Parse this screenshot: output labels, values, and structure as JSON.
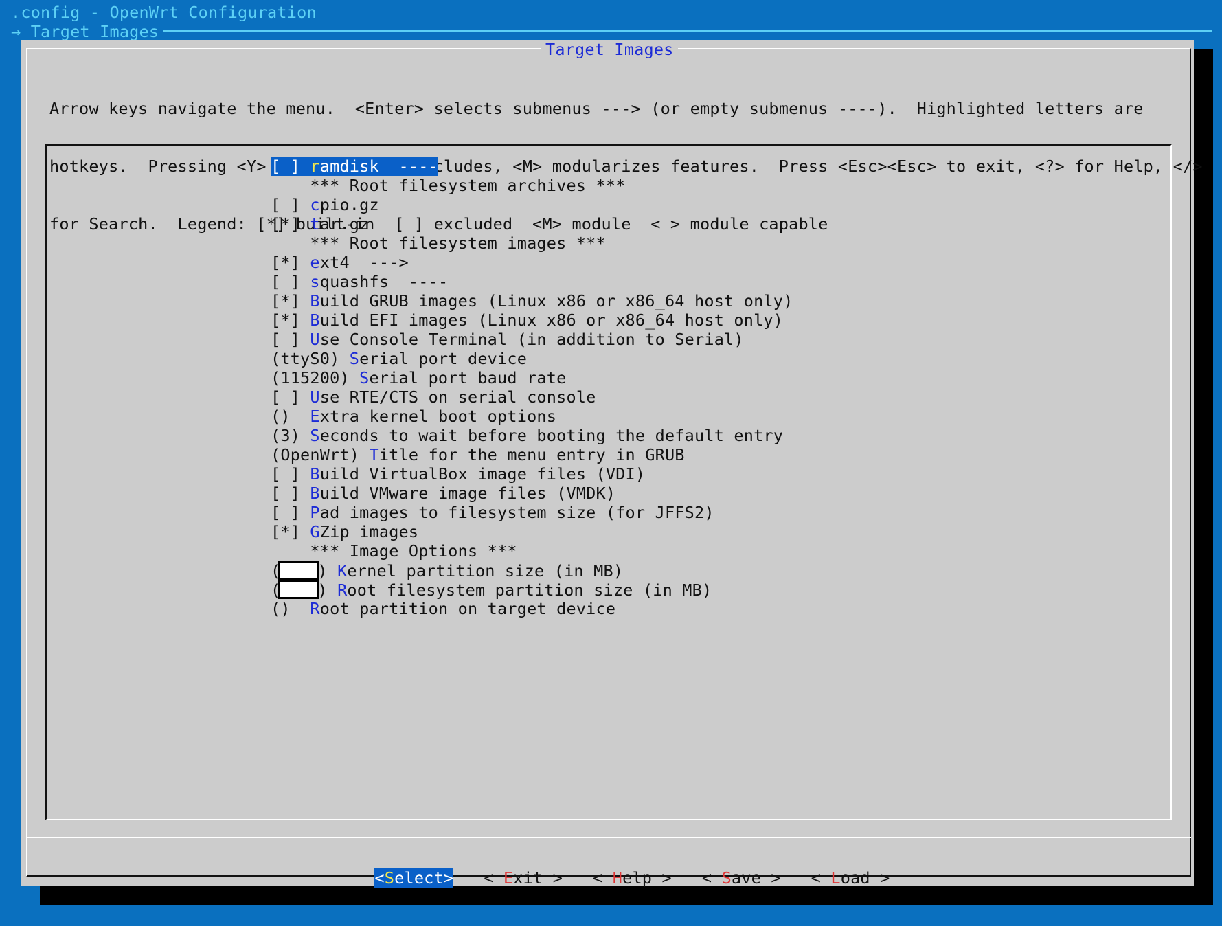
{
  "window": {
    "title": ".config - OpenWrt Configuration",
    "breadcrumb": "→ Target Images"
  },
  "dialog": {
    "title": "Target Images",
    "help_lines": [
      "Arrow keys navigate the menu.  <Enter> selects submenus ---> (or empty submenus ----).  Highlighted letters are",
      "hotkeys.  Pressing <Y> includes, <N> excludes, <M> modularizes features.  Press <Esc><Esc> to exit, <?> for Help, </>",
      "for Search.  Legend: [*] built-in  [ ] excluded  <M> module  < > module capable"
    ]
  },
  "menu": {
    "items": [
      {
        "prefix": "[ ] ",
        "hotkey": "r",
        "rest": "amdisk  ----",
        "selected": true,
        "interactive": true
      },
      {
        "prefix": "    ",
        "hotkey": "",
        "rest": "*** Root filesystem archives ***",
        "interactive": false
      },
      {
        "prefix": "[ ] ",
        "hotkey": "c",
        "rest": "pio.gz",
        "interactive": true
      },
      {
        "prefix": "[*] ",
        "hotkey": "t",
        "rest": "ar.gz",
        "interactive": true
      },
      {
        "prefix": "    ",
        "hotkey": "",
        "rest": "*** Root filesystem images ***",
        "interactive": false
      },
      {
        "prefix": "[*] ",
        "hotkey": "e",
        "rest": "xt4  --->",
        "interactive": true
      },
      {
        "prefix": "[ ] ",
        "hotkey": "s",
        "rest": "quashfs  ----",
        "interactive": true
      },
      {
        "prefix": "[*] ",
        "hotkey": "B",
        "rest": "uild GRUB images (Linux x86 or x86_64 host only)",
        "interactive": true
      },
      {
        "prefix": "[*] ",
        "hotkey": "B",
        "rest": "uild EFI images (Linux x86 or x86_64 host only)",
        "interactive": true
      },
      {
        "prefix": "[ ] ",
        "hotkey": "U",
        "rest": "se Console Terminal (in addition to Serial)",
        "interactive": true
      },
      {
        "prefix": "(ttyS0) ",
        "hotkey": "S",
        "rest": "erial port device",
        "interactive": true
      },
      {
        "prefix": "(115200) ",
        "hotkey": "S",
        "rest": "erial port baud rate",
        "interactive": true
      },
      {
        "prefix": "[ ] ",
        "hotkey": "U",
        "rest": "se RTE/CTS on serial console",
        "interactive": true
      },
      {
        "prefix": "()  ",
        "hotkey": "E",
        "rest": "xtra kernel boot options",
        "interactive": true
      },
      {
        "prefix": "(3) ",
        "hotkey": "S",
        "rest": "econds to wait before booting the default entry",
        "interactive": true
      },
      {
        "prefix": "(OpenWrt) ",
        "hotkey": "T",
        "rest": "itle for the menu entry in GRUB",
        "interactive": true
      },
      {
        "prefix": "[ ] ",
        "hotkey": "B",
        "rest": "uild VirtualBox image files (VDI)",
        "interactive": true
      },
      {
        "prefix": "[ ] ",
        "hotkey": "B",
        "rest": "uild VMware image files (VMDK)",
        "interactive": true
      },
      {
        "prefix": "[ ] ",
        "hotkey": "P",
        "rest": "ad images to filesystem size (for JFFS2)",
        "interactive": true
      },
      {
        "prefix": "[*] ",
        "hotkey": "G",
        "rest": "Zip images",
        "interactive": true
      },
      {
        "prefix": "    ",
        "hotkey": "",
        "rest": "*** Image Options ***",
        "interactive": false
      },
      {
        "prefix": "(",
        "box": true,
        "prefix_after": ") ",
        "hotkey": "K",
        "rest": "ernel partition size (in MB)",
        "interactive": true
      },
      {
        "prefix": "(",
        "box": true,
        "prefix_after": ") ",
        "hotkey": "R",
        "rest": "oot filesystem partition size (in MB)",
        "interactive": true
      },
      {
        "prefix": "()  ",
        "hotkey": "R",
        "rest": "oot partition on target device",
        "interactive": true
      }
    ]
  },
  "buttons": {
    "select": {
      "open": "<",
      "hotkey": "S",
      "rest": "elect",
      "close": ">"
    },
    "exit": {
      "open": "< ",
      "hotkey": "E",
      "rest": "xit",
      "close": " >"
    },
    "help": {
      "open": "< ",
      "hotkey": "H",
      "rest": "elp",
      "close": " >"
    },
    "save": {
      "open": "< ",
      "hotkey": "S",
      "rest": "ave",
      "close": " >"
    },
    "load": {
      "open": "< ",
      "hotkey": "L",
      "rest": "oad",
      "close": " >"
    }
  },
  "colors": {
    "background": "#0a70bf",
    "dialog": "#cccccc",
    "hotkey": "#1c2bd6",
    "button_hotkey": "#e03434",
    "highlight": "#0a60c8",
    "highlight_hotkey": "#f5e84a"
  }
}
